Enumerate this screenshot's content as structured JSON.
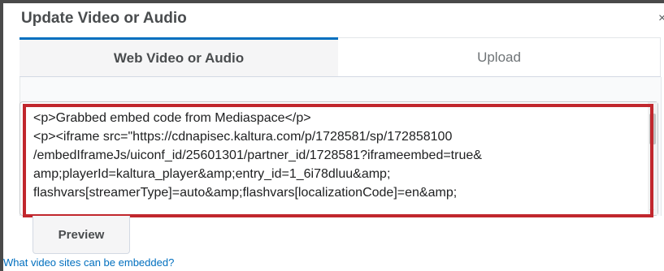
{
  "dialog": {
    "title": "Update Video or Audio",
    "close_icon": "close-icon"
  },
  "tabs": [
    {
      "label": "Web Video or Audio",
      "selected": true
    },
    {
      "label": "Upload",
      "selected": false
    }
  ],
  "embed_code": {
    "lines": [
      "<p>Grabbed embed code from Mediaspace</p>",
      "<p><iframe src=\"https://cdnapisec.kaltura.com/p/1728581/sp/172858100",
      "/embedIframeJs/uiconf_id/25601301/partner_id/1728581?iframeembed=true&",
      "amp;playerId=kaltura_player&amp;entry_id=1_6i78dluu&amp;",
      "flashvars[streamerType]=auto&amp;flashvars[localizationCode]=en&amp;"
    ]
  },
  "preview_label": "Preview",
  "help_link": "What video sites can be embedded?",
  "colors": {
    "accent": "#006fbf",
    "highlight": "#c1272d",
    "text": "#494c4e"
  }
}
